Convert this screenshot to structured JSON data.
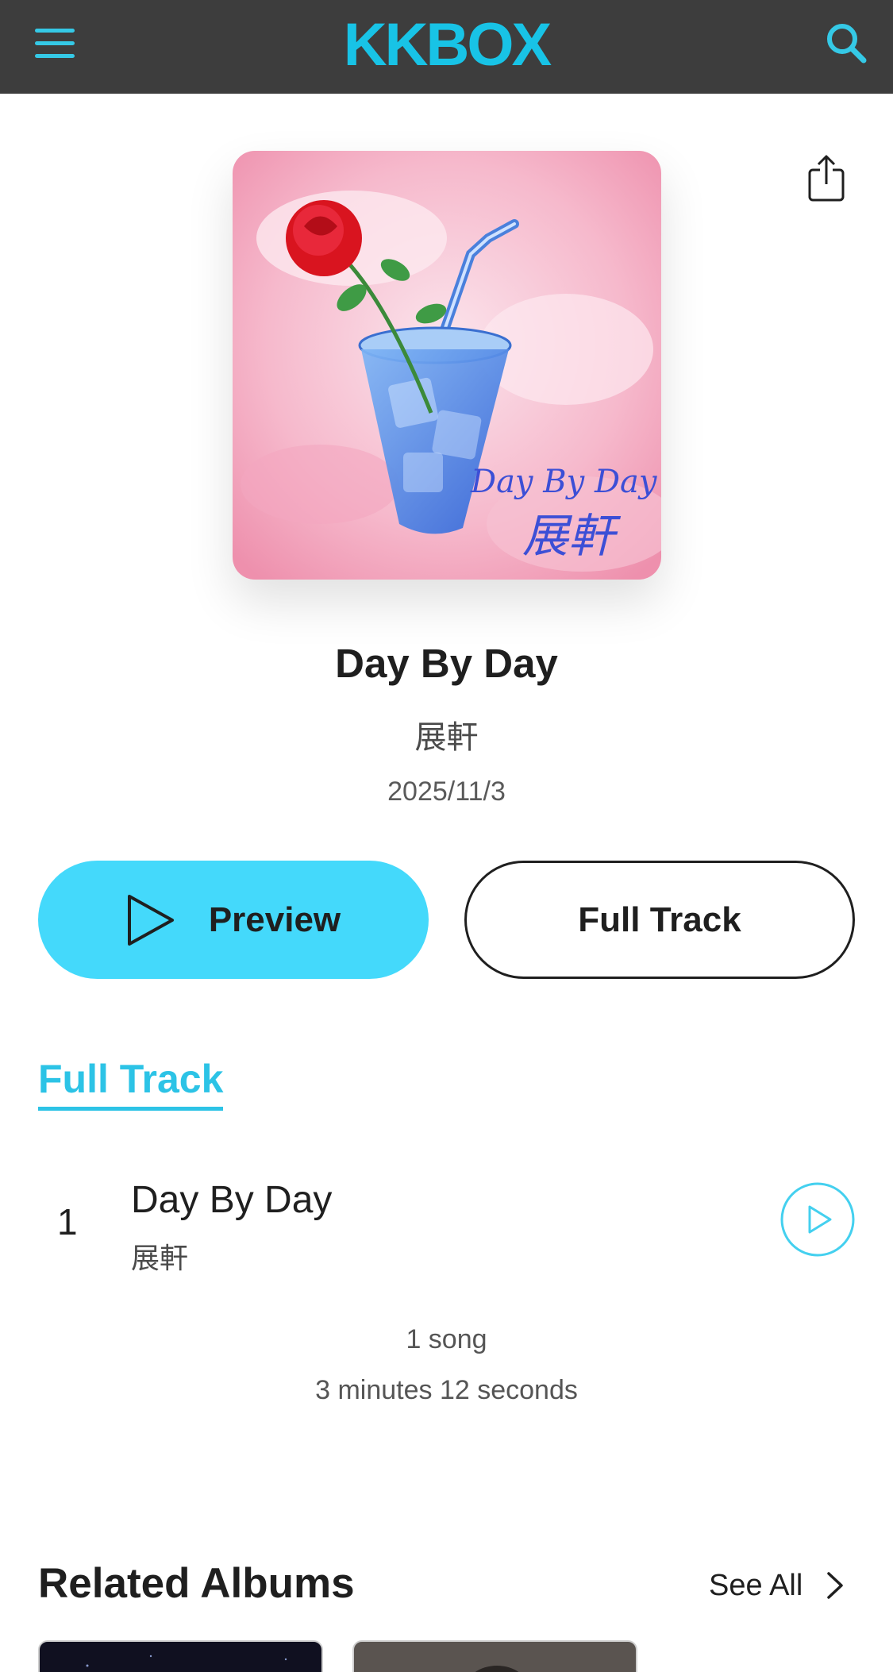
{
  "header": {
    "logo": "KKBOX",
    "menu_icon": "hamburger-menu-icon",
    "search_icon": "search-icon"
  },
  "album": {
    "cover_text_latin": "Day By Day",
    "cover_text_cjk": "展軒",
    "title": "Day By Day",
    "artist": "展軒",
    "release_date": "2025/11/3"
  },
  "actions": {
    "preview_label": "Preview",
    "full_track_label": "Full Track",
    "share_icon": "share-icon"
  },
  "section": {
    "tab_label": "Full Track"
  },
  "tracks": [
    {
      "number": "1",
      "title": "Day By Day",
      "artist": "展軒"
    }
  ],
  "summary": {
    "songs": "1 song",
    "duration": "3 minutes 12 seconds"
  },
  "related": {
    "title": "Related Albums",
    "see_all": "See All"
  },
  "colors": {
    "accent": "#2cc3e6",
    "preview_button": "#44d9fb",
    "header_bg": "#3d3d3d"
  }
}
